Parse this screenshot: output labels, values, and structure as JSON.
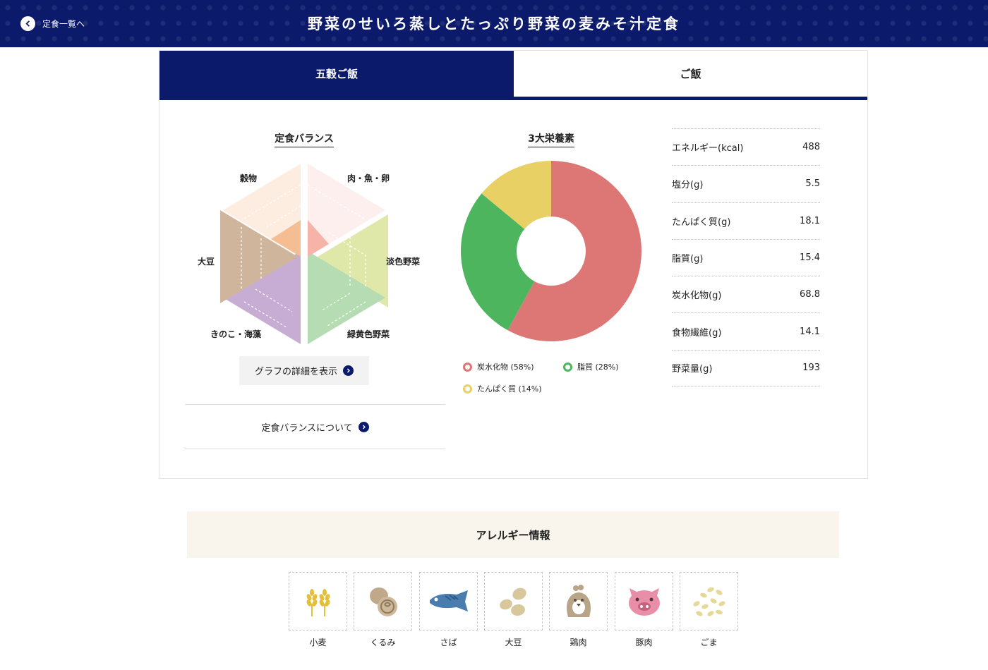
{
  "header": {
    "back_label": "定食一覧へ",
    "title": "野菜のせいろ蒸しとたっぷり野菜の麦みそ汁定食"
  },
  "tabs": [
    {
      "label": "五穀ご飯",
      "active": true
    },
    {
      "label": "ご飯",
      "active": false
    }
  ],
  "balance": {
    "title": "定食バランス",
    "labels": {
      "grains": "穀物",
      "meat_fish_egg": "肉・魚・卵",
      "light_vegetables": "淡色野菜",
      "green_yellow_vegetables": "緑黄色野菜",
      "mushroom_seaweed": "きのこ・海藻",
      "soybean": "大豆"
    },
    "detail_button": "グラフの詳細を表示",
    "about_link": "定食バランスについて",
    "colors": {
      "grains": "#f4be92",
      "meat_fish_egg": "#f6b3a8",
      "light_vegetables": "#dfe8a8",
      "green_yellow_vegetables": "#b5dcb2",
      "mushroom_seaweed": "#c7acd4",
      "soybean": "#d0b59d"
    },
    "label_colors": {
      "grains": "#e08a3c",
      "meat_fish_egg": "#e04e38",
      "light_vegetables": "#a5b33c",
      "green_yellow_vegetables": "#52a94d",
      "mushroom_seaweed": "#9b67b4",
      "soybean": "#a77d52"
    }
  },
  "macros": {
    "title": "3大栄養素",
    "legend": [
      {
        "label": "炭水化物 (58%)",
        "color": "#dd7776"
      },
      {
        "label": "脂質 (28%)",
        "color": "#4db55e"
      },
      {
        "label": "たんぱく質 (14%)",
        "color": "#e8d065"
      }
    ]
  },
  "chart_data": {
    "type": "pie",
    "categories": [
      "炭水化物",
      "脂質",
      "たんぱく質"
    ],
    "values": [
      58,
      28,
      14
    ]
  },
  "nutrition": [
    {
      "label": "エネルギー(kcal)",
      "value": "488"
    },
    {
      "label": "塩分(g)",
      "value": "5.5"
    },
    {
      "label": "たんぱく質(g)",
      "value": "18.1"
    },
    {
      "label": "脂質(g)",
      "value": "15.4"
    },
    {
      "label": "炭水化物(g)",
      "value": "68.8"
    },
    {
      "label": "食物繊維(g)",
      "value": "14.1"
    },
    {
      "label": "野菜量(g)",
      "value": "193"
    }
  ],
  "allergy": {
    "title": "アレルギー情報",
    "items": [
      {
        "label": "小麦",
        "icon": "wheat-icon"
      },
      {
        "label": "くるみ",
        "icon": "walnut-icon"
      },
      {
        "label": "さば",
        "icon": "mackerel-icon"
      },
      {
        "label": "大豆",
        "icon": "soybean-icon"
      },
      {
        "label": "鶏肉",
        "icon": "chicken-icon"
      },
      {
        "label": "豚肉",
        "icon": "pork-icon"
      },
      {
        "label": "ごま",
        "icon": "sesame-icon"
      }
    ]
  }
}
